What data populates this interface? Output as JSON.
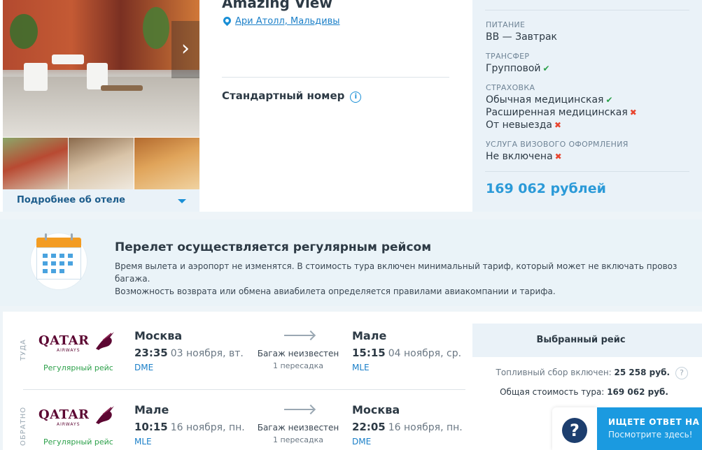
{
  "hotel": {
    "name": "Amazing View",
    "location": "Ари Атолл, Мальдивы",
    "room": "Стандартный номер",
    "more_label": "Подробнее об отеле"
  },
  "sidebar": {
    "meal_heading": "ПИТАНИЕ",
    "meal_value": "BB — Завтрак",
    "transfer_heading": "ТРАНСФЕР",
    "transfer_value": "Групповой",
    "insurance_heading": "СТРАХОВКА",
    "insurance_items": [
      {
        "label": "Обычная медицинская",
        "included": true
      },
      {
        "label": "Расширенная медицинская",
        "included": false
      },
      {
        "label": "От невыезда",
        "included": false
      }
    ],
    "visa_heading": "УСЛУГА ВИЗОВОГО ОФОРМЛЕНИЯ",
    "visa_value": "Не включена",
    "price": "169 062 рублей"
  },
  "notice": {
    "title": "Перелет осуществляется регулярным рейсом",
    "line1": "Время вылета и аэропорт не изменятся. В стоимость тура включен минимальный тариф, который может не включать провоз багажа.",
    "line2": "Возможность возврата или обмена авиабилета определяется правилами авиакомпании и тарифа."
  },
  "flights": [
    {
      "direction": "ТУДА",
      "airline_word": "QATAR",
      "airline_sub": "AIRWAYS",
      "type": "Регулярный рейс",
      "from_city": "Москва",
      "from_time": "23:35",
      "from_date": "03 ноября, вт.",
      "from_code": "DME",
      "baggage": "Багаж неизвестен",
      "stops": "1 пересадка",
      "to_city": "Мале",
      "to_time": "15:15",
      "to_date": "04 ноября, ср.",
      "to_code": "MLE"
    },
    {
      "direction": "ОБРАТНО",
      "airline_word": "QATAR",
      "airline_sub": "AIRWAYS",
      "type": "Регулярный рейс",
      "from_city": "Мале",
      "from_time": "10:15",
      "from_date": "16 ноября, пн.",
      "from_code": "MLE",
      "baggage": "Багаж неизвестен",
      "stops": "1 пересадка",
      "to_city": "Москва",
      "to_time": "22:05",
      "to_date": "16 ноября, пн.",
      "to_code": "DME"
    }
  ],
  "summary": {
    "selected_label": "Выбранный рейс",
    "fuel_label": "Топливный сбор включен:",
    "fuel_value": "25 258 руб.",
    "total_label": "Общая стоимость тура:",
    "total_value": "169 062 руб."
  },
  "help": {
    "title": "ИЩЕТЕ ОТВЕТ НА ВО",
    "subtitle": "Посмотрите здесь!"
  },
  "colors": {
    "accent": "#1a8fd6",
    "ok": "#2ca04a",
    "no": "#e8452f",
    "qatar": "#5c0632"
  }
}
